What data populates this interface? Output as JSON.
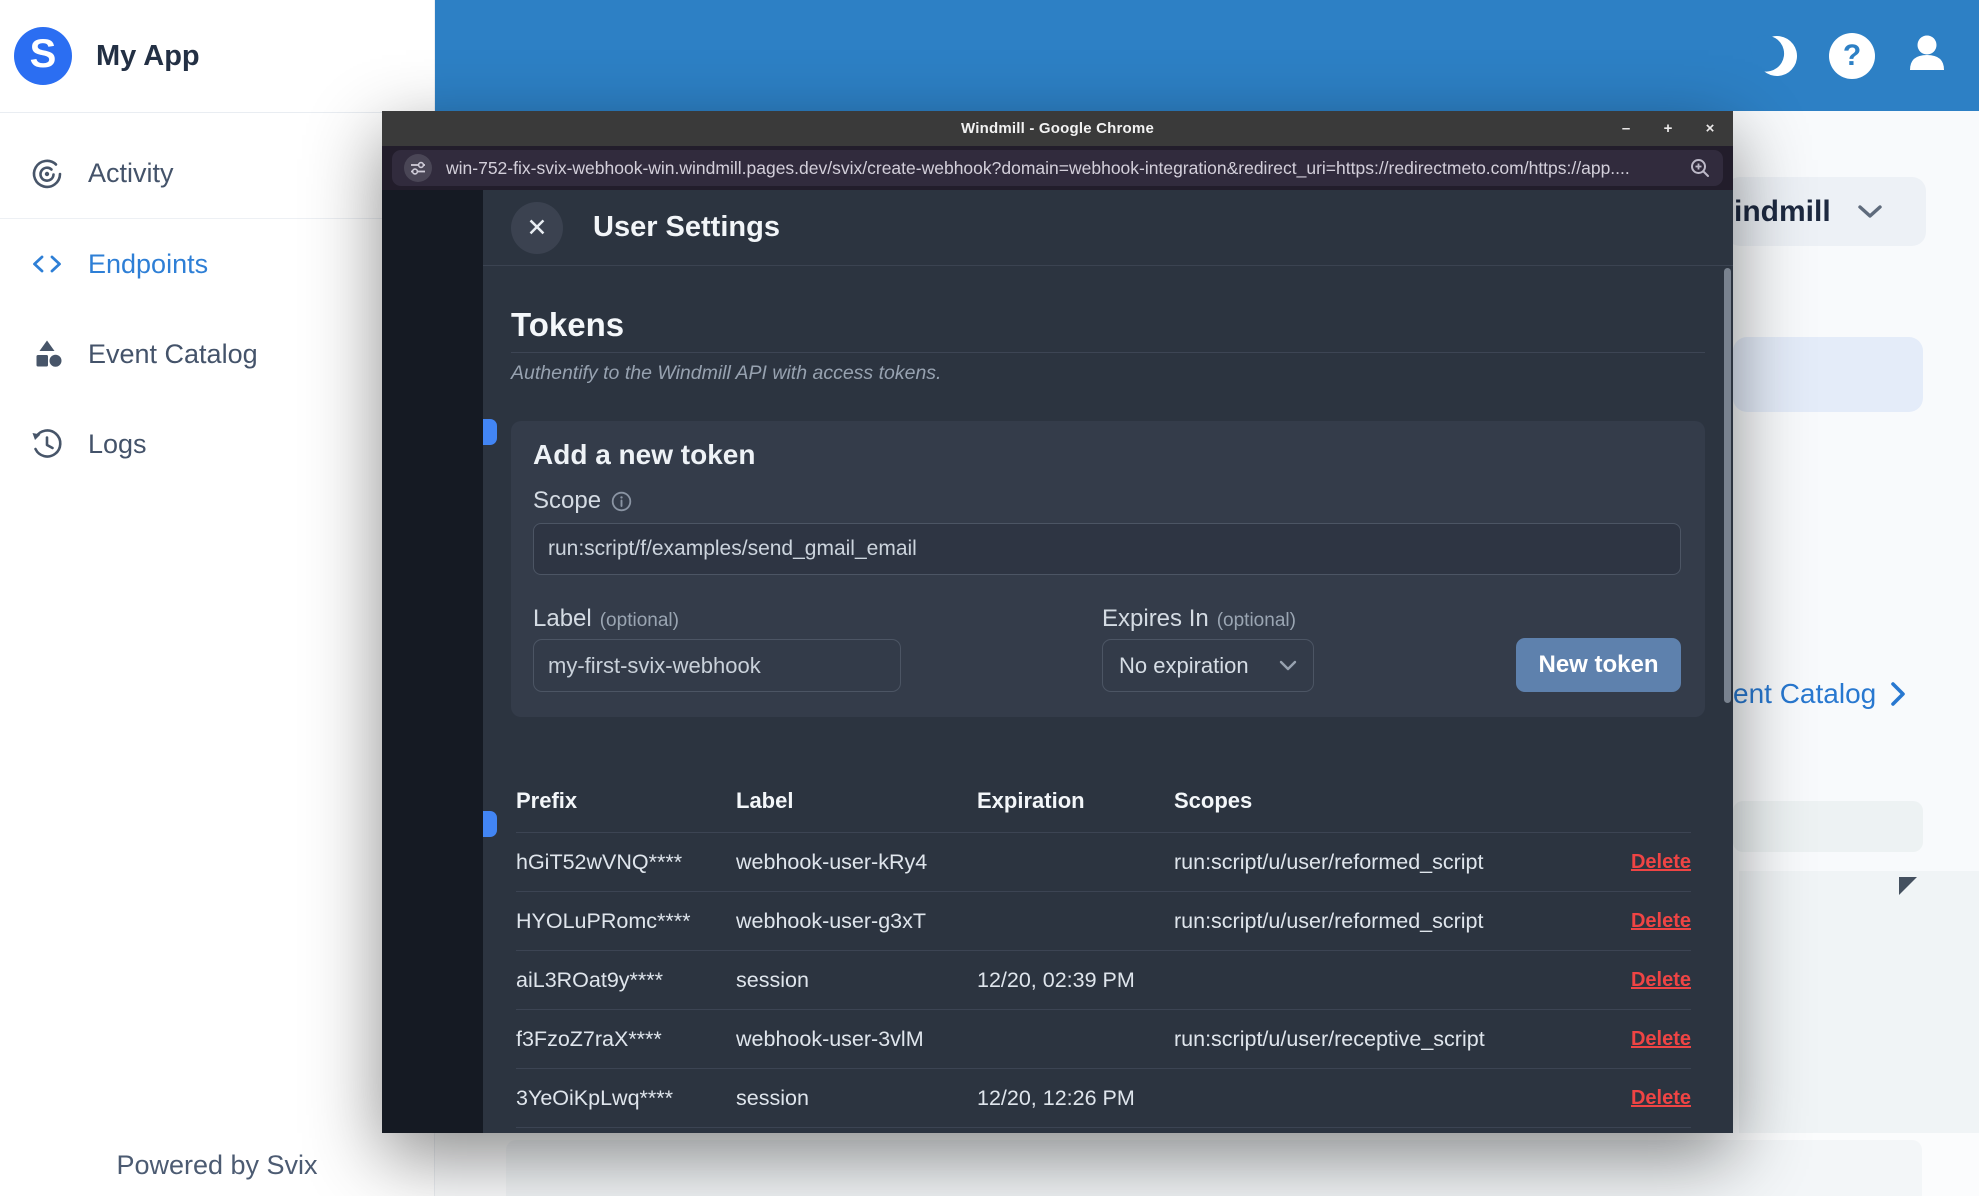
{
  "app": {
    "brand": "My App",
    "powered_by": "Powered by Svix",
    "sidebar_items": [
      {
        "label": "Activity"
      },
      {
        "label": "Endpoints"
      },
      {
        "label": "Event Catalog"
      },
      {
        "label": "Logs"
      }
    ],
    "background": {
      "workspace_dropdown_partial": "indmill",
      "catalog_link_partial": "ent Catalog"
    }
  },
  "chrome": {
    "title": "Windmill - Google Chrome",
    "controls": {
      "minimize": "–",
      "maximize": "+",
      "close": "×"
    },
    "url": "win-752-fix-svix-webhook-win.windmill.pages.dev/svix/create-webhook?domain=webhook-integration&redirect_uri=https://redirectmeto.com/https://app...."
  },
  "modal": {
    "title": "User Settings",
    "close": "✕",
    "section_heading": "Tokens",
    "section_subheading": "Authentify to the Windmill API with access tokens.",
    "form": {
      "heading": "Add a new token",
      "scope_label": "Scope",
      "scope_value": "run:script/f/examples/send_gmail_email",
      "label_label": "Label",
      "optional": "(optional)",
      "label_value": "my-first-svix-webhook",
      "expires_label": "Expires In",
      "expires_value": "No expiration",
      "submit_label": "New token"
    },
    "table": {
      "headers": [
        "Prefix",
        "Label",
        "Expiration",
        "Scopes"
      ],
      "delete_label": "Delete",
      "rows": [
        {
          "prefix": "hGiT52wVNQ****",
          "label": "webhook-user-kRy4",
          "expiration": "",
          "scopes": "run:script/u/user/reformed_script"
        },
        {
          "prefix": "HYOLuPRomc****",
          "label": "webhook-user-g3xT",
          "expiration": "",
          "scopes": "run:script/u/user/reformed_script"
        },
        {
          "prefix": "aiL3ROat9y****",
          "label": "session",
          "expiration": "12/20, 02:39 PM",
          "scopes": ""
        },
        {
          "prefix": "f3FzoZ7raX****",
          "label": "webhook-user-3vlM",
          "expiration": "",
          "scopes": "run:script/u/user/receptive_script"
        },
        {
          "prefix": "3YeOiKpLwq****",
          "label": "session",
          "expiration": "12/20, 12:26 PM",
          "scopes": ""
        }
      ]
    }
  },
  "colors": {
    "topbar_blue": "#2d80c5",
    "logo_blue": "#2b6ef2",
    "active_nav_blue": "#2e7fd6",
    "modal_bg": "#2c3440",
    "card_bg": "#343c4a",
    "button_blue": "#5e81ad",
    "delete_red": "#ef4444",
    "link_blue": "#2878d0"
  }
}
